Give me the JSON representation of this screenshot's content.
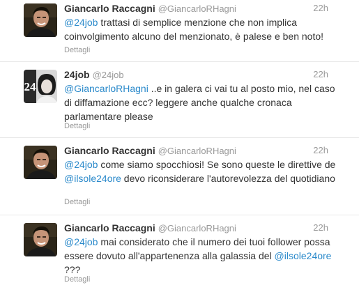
{
  "colors": {
    "link": "#2b8acb",
    "muted": "#999999",
    "text": "#333333"
  },
  "tweets": [
    {
      "fullname": "Giancarlo Raccagni",
      "username": "@GiancarloRHagni",
      "time": "22h",
      "mention1": "@24job",
      "text1": " trattasi di semplice menzione che non implica coinvolgimento alcuno del menzionato, è palese e ben noto!",
      "details": "Dettagli"
    },
    {
      "fullname": "24job",
      "username": "@24job",
      "time": "22h",
      "avatar_label": "24",
      "mention1": "@GiancarloRHagni",
      "text1": " ..e in galera ci vai tu al posto mio, nel caso di diffamazione ecc? leggere anche qualche cronaca parlamentare please",
      "details": "Dettagli"
    },
    {
      "fullname": "Giancarlo Raccagni",
      "username": "@GiancarloRHagni",
      "time": "22h",
      "mention1": "@24job",
      "text1": " come siamo spocchiosi! Se sono queste le direttive de ",
      "mention2": "@ilsole24ore",
      "text2": " devo riconsiderare l'autorevolezza del quotidiano",
      "details": "Dettagli"
    },
    {
      "fullname": "Giancarlo Raccagni",
      "username": "@GiancarloRHagni",
      "time": "22h",
      "mention1": "@24job",
      "text1": " mai considerato che il numero dei tuoi follower possa essere dovuto all'appartenenza alla galassia del ",
      "mention2": "@ilsole24ore",
      "text2": " ???",
      "details": "Dettagli"
    }
  ]
}
